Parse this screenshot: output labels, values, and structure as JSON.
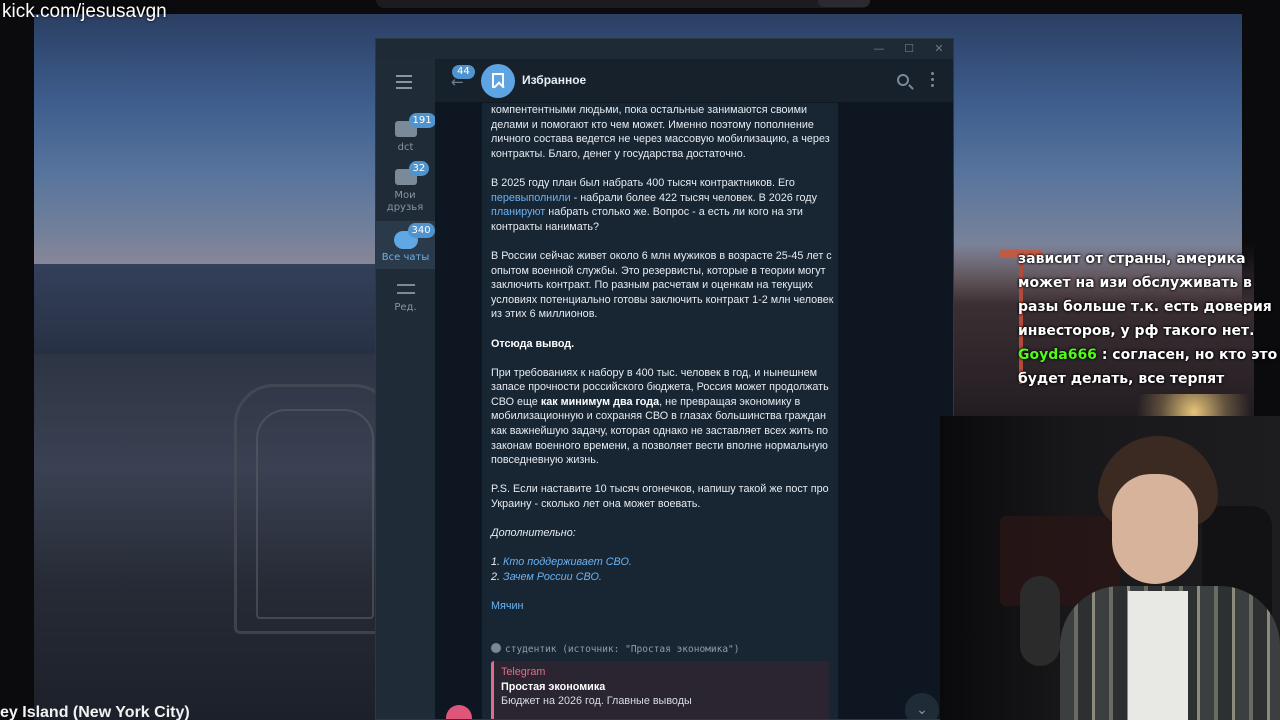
{
  "stream": {
    "channel_url": "kick.com/jesusavgn",
    "video_caption": "ey Island (New York City)"
  },
  "window_controls": {
    "minimize": "—",
    "maximize": "☐",
    "close": "✕"
  },
  "sidebar": {
    "folders": [
      {
        "label": "dct",
        "badge": "191",
        "icon": "folder-icon"
      },
      {
        "label": "Мои друзья",
        "badge": "32",
        "icon": "folder-icon"
      },
      {
        "label": "Все чаты",
        "badge": "340",
        "icon": "chats-icon",
        "active": true
      },
      {
        "label": "Ред.",
        "icon": "edit-folders-icon"
      }
    ]
  },
  "header": {
    "back_badge": "44",
    "title": "Избранное",
    "avatar_icon": "bookmark-icon"
  },
  "message": {
    "paragraphs": [
      "компентентными людьми, пока остальные занимаются своими делами и помогают кто чем может. Именно поэтому пополнение личного состава ведется не через массовую мобилизацию, а через контракты. Благо, денег у государства достаточно.",
      "В России сейчас живет около 6 млн мужиков в возрасте 25-45 лет с опытом военной службы. Это резервисты, которые в теории могут заключить контракт. По разным расчетам и оценкам на текущих условиях потенциально готовы заключить контракт 1-2 млн человек из этих 6 миллионов."
    ],
    "plan": {
      "p1": "В 2025 году план был набрать 400 тысяч контрактников. Его ",
      "link1": "перевыполнили",
      "p2": " - набрали более 422 тысяч человек. В 2026 году ",
      "link2": "планируют",
      "p3": " набрать столько же. Вопрос - а есть ли кого на эти контракты нанимать?"
    },
    "conclusion_heading": "Отсюда вывод.",
    "conclusion": {
      "p1": "При требованиях к набору в 400 тыс. человек в год, и нынешнем запасе прочности российского бюджета, Россия может продолжать СВО еще ",
      "bold": "как минимум два года",
      "p2": ", не превращая экономику в мобилизационную и сохраняя СВО в глазах большинства граждан как важнейшую задачу, которая однако не заставляет всех жить по законам военного времени, а позволяет вести вполне нормальную повседневную жизнь."
    },
    "ps": "P.S. Если наставите 10 тысяч огонечков, напишу такой же пост про Украину - сколько лет она может воевать.",
    "additional_heading": "Дополнительно:",
    "additional_links": [
      {
        "num": "1. ",
        "text": "Кто поддерживает СВО."
      },
      {
        "num": "2. ",
        "text": "Зачем России СВО."
      }
    ],
    "author": "Мячин",
    "via": "студентик (источник: \"Простая экономика\")",
    "preview": {
      "source": "Telegram",
      "title": "Простая экономика",
      "subtitle": "Бюджет на 2026 год. Главные выводы"
    }
  },
  "stream_chat": {
    "line1": "зависит от страны, америка может на изи обслуживать в разы больше т.к. есть доверия инвесторов, у рф такого нет.",
    "nick": "Goyda666",
    "line2": ": согласен, но кто это будет делать, все терпят"
  },
  "colors": {
    "tg_bg": "#0e1621",
    "tg_panel": "#17212b",
    "accent": "#5ea4e2",
    "link": "#6ab3f3",
    "chat_nick": "#53fc18"
  }
}
